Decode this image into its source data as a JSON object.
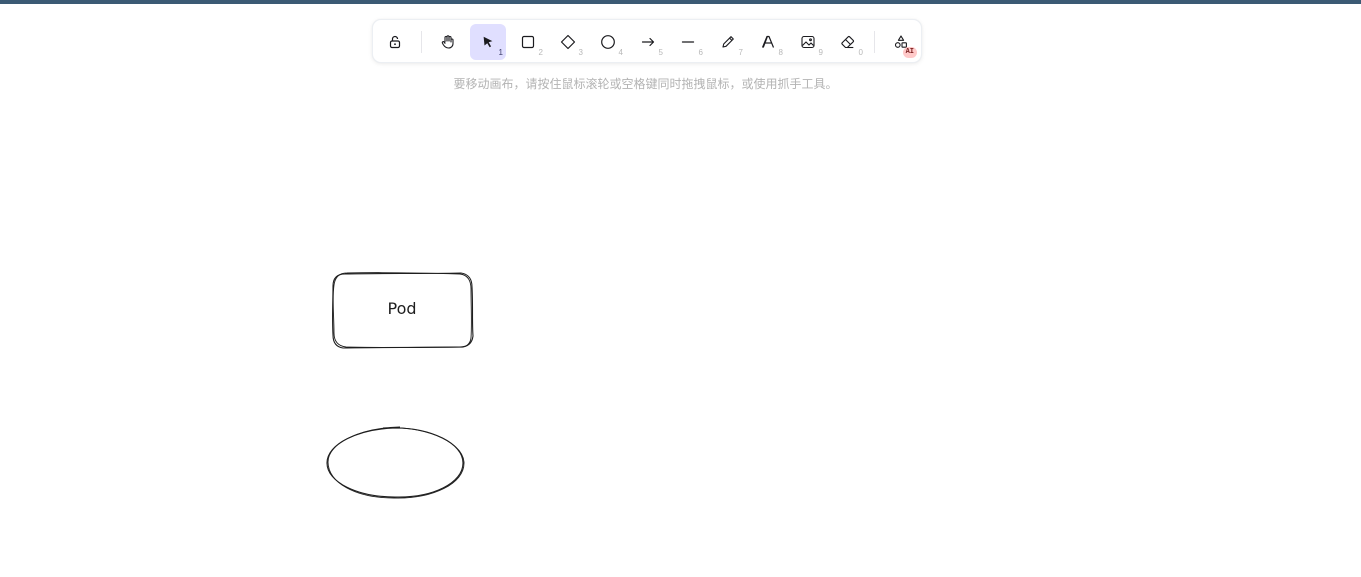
{
  "window": {
    "accent_bar_color": "#3b5a74"
  },
  "toolbar": {
    "tools": [
      {
        "name": "lock",
        "icon": "lock-icon",
        "key": ""
      },
      {
        "name": "hand",
        "icon": "hand-icon",
        "key": ""
      },
      {
        "name": "selection",
        "icon": "pointer-icon",
        "key": "1",
        "active": true
      },
      {
        "name": "rectangle",
        "icon": "square-icon",
        "key": "2"
      },
      {
        "name": "diamond",
        "icon": "diamond-icon",
        "key": "3"
      },
      {
        "name": "ellipse",
        "icon": "circle-icon",
        "key": "4"
      },
      {
        "name": "arrow",
        "icon": "arrow-right-icon",
        "key": "5"
      },
      {
        "name": "line",
        "icon": "line-icon",
        "key": "6"
      },
      {
        "name": "draw",
        "icon": "pencil-icon",
        "key": "7"
      },
      {
        "name": "text",
        "icon": "text-icon",
        "key": "8"
      },
      {
        "name": "image",
        "icon": "image-icon",
        "key": "9"
      },
      {
        "name": "eraser",
        "icon": "eraser-icon",
        "key": "0"
      },
      {
        "name": "more-shapes",
        "icon": "shapes-icon",
        "key": ""
      }
    ],
    "ai_badge": "AI",
    "active_color": "#e0dfff"
  },
  "hint": {
    "text": "要移动画布，请按住鼠标滚轮或空格键同时拖拽鼠标，或使用抓手工具。"
  },
  "canvas": {
    "elements": [
      {
        "type": "rectangle",
        "label": "Pod"
      },
      {
        "type": "ellipse",
        "label": ""
      }
    ],
    "stroke_color": "#1e1e1e"
  }
}
